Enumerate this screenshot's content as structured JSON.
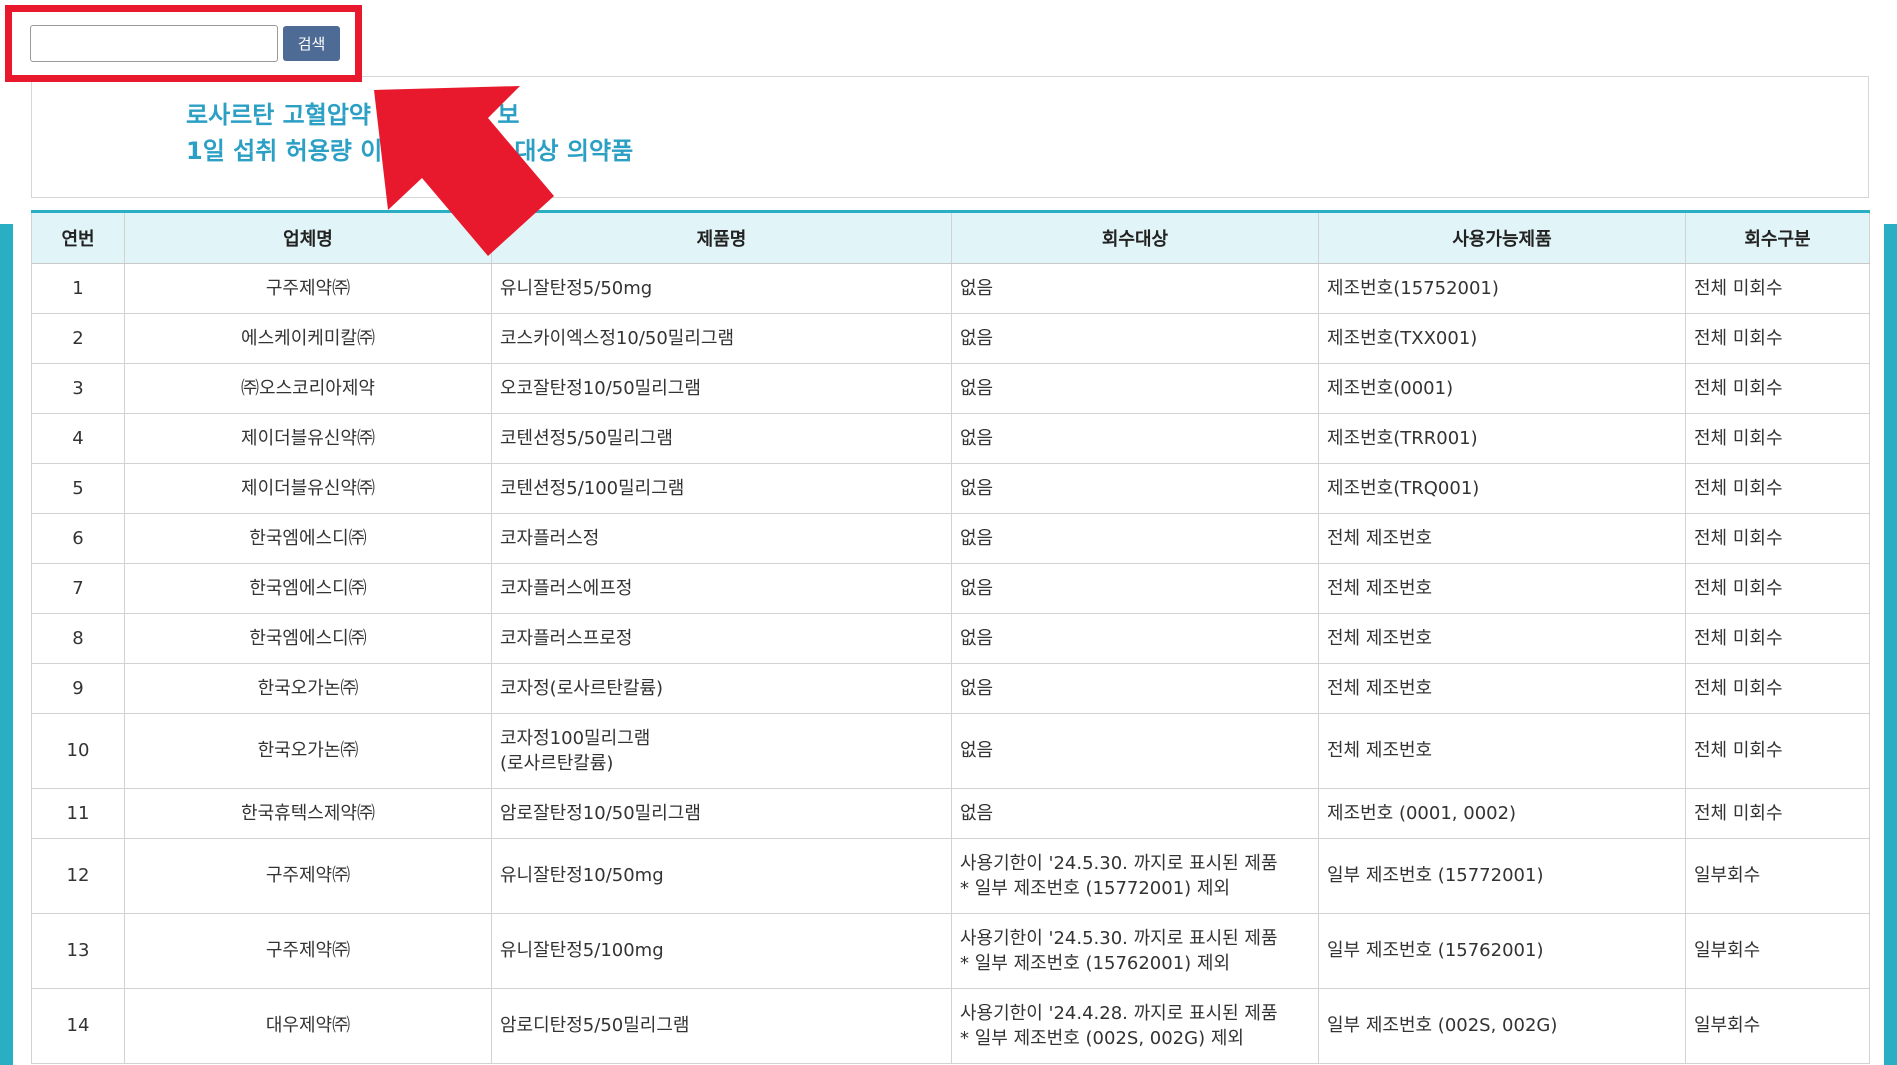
{
  "search": {
    "input_value": "",
    "button_label": "검색"
  },
  "notice": {
    "line1": "로사르탄 고혈압약 ",
    "line1_end": "보",
    "line2": "1일 섭취 허용량 이니",
    "line2_end": "대상 의약품"
  },
  "colors": {
    "accent": "#2aaec3",
    "notice_text": "#2b9fc4",
    "header_bg": "#e1f4f7",
    "button_bg": "#4e6b96",
    "highlight": "#e8192c"
  },
  "icons": {
    "arrow": "red-arrow-icon"
  },
  "table": {
    "headers": [
      "연번",
      "업체명",
      "제품명",
      "회수대상",
      "사용가능제품",
      "회수구분"
    ],
    "rows": [
      {
        "no": "1",
        "company": "구주제약㈜",
        "product": "유니잘탄정5/50mg",
        "target": "없음",
        "usable": "제조번호(15752001)",
        "type": "전체 미회수"
      },
      {
        "no": "2",
        "company": "에스케이케미칼㈜",
        "product": "코스카이엑스정10/50밀리그램",
        "target": "없음",
        "usable": "제조번호(TXX001)",
        "type": "전체 미회수"
      },
      {
        "no": "3",
        "company": "㈜오스코리아제약",
        "product": "오코잘탄정10/50밀리그램",
        "target": "없음",
        "usable": "제조번호(0001)",
        "type": "전체 미회수"
      },
      {
        "no": "4",
        "company": "제이더블유신약㈜",
        "product": "코텐션정5/50밀리그램",
        "target": "없음",
        "usable": "제조번호(TRR001)",
        "type": "전체 미회수"
      },
      {
        "no": "5",
        "company": "제이더블유신약㈜",
        "product": "코텐션정5/100밀리그램",
        "target": "없음",
        "usable": "제조번호(TRQ001)",
        "type": "전체 미회수"
      },
      {
        "no": "6",
        "company": "한국엠에스디㈜",
        "product": "코자플러스정",
        "target": "없음",
        "usable": "전체 제조번호",
        "type": "전체 미회수"
      },
      {
        "no": "7",
        "company": "한국엠에스디㈜",
        "product": "코자플러스에프정",
        "target": "없음",
        "usable": "전체 제조번호",
        "type": "전체 미회수"
      },
      {
        "no": "8",
        "company": "한국엠에스디㈜",
        "product": "코자플러스프로정",
        "target": "없음",
        "usable": "전체 제조번호",
        "type": "전체 미회수"
      },
      {
        "no": "9",
        "company": "한국오가논㈜",
        "product": "코자정(로사르탄칼륨)",
        "target": "없음",
        "usable": "전체 제조번호",
        "type": "전체 미회수"
      },
      {
        "no": "10",
        "company": "한국오가논㈜",
        "product": "코자정100밀리그램\n(로사르탄칼륨)",
        "target": "없음",
        "usable": "전체 제조번호",
        "type": "전체 미회수"
      },
      {
        "no": "11",
        "company": "한국휴텍스제약㈜",
        "product": "암로잘탄정10/50밀리그램",
        "target": "없음",
        "usable": "제조번호 (0001, 0002)",
        "type": "전체 미회수"
      },
      {
        "no": "12",
        "company": "구주제약㈜",
        "product": "유니잘탄정10/50mg",
        "target": "사용기한이 '24.5.30. 까지로 표시된 제품\n* 일부 제조번호 (15772001) 제외",
        "usable": "일부 제조번호 (15772001)",
        "type": "일부회수"
      },
      {
        "no": "13",
        "company": "구주제약㈜",
        "product": "유니잘탄정5/100mg",
        "target": "사용기한이 '24.5.30. 까지로 표시된 제품\n* 일부 제조번호 (15762001) 제외",
        "usable": "일부 제조번호 (15762001)",
        "type": "일부회수"
      },
      {
        "no": "14",
        "company": "대우제약㈜",
        "product": "암로디탄정5/50밀리그램",
        "target": "사용기한이 '24.4.28. 까지로 표시된 제품\n* 일부 제조번호 (002S, 002G) 제외",
        "usable": "일부 제조번호 (002S, 002G)",
        "type": "일부회수"
      }
    ]
  }
}
